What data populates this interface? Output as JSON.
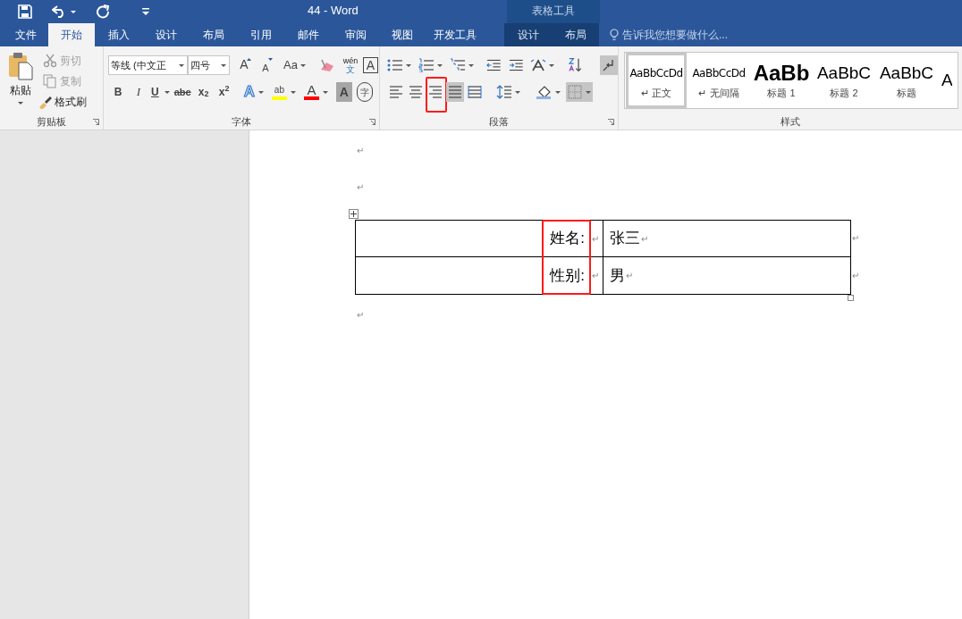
{
  "window": {
    "title": "44 - Word",
    "context_title": "表格工具"
  },
  "tabs": [
    {
      "label": "文件",
      "selected": false,
      "context": false
    },
    {
      "label": "开始",
      "selected": true,
      "context": false
    },
    {
      "label": "插入",
      "selected": false,
      "context": false
    },
    {
      "label": "设计",
      "selected": false,
      "context": false
    },
    {
      "label": "布局",
      "selected": false,
      "context": false
    },
    {
      "label": "引用",
      "selected": false,
      "context": false
    },
    {
      "label": "邮件",
      "selected": false,
      "context": false
    },
    {
      "label": "审阅",
      "selected": false,
      "context": false
    },
    {
      "label": "视图",
      "selected": false,
      "context": false
    },
    {
      "label": "开发工具",
      "selected": false,
      "context": false
    },
    {
      "label": "设计",
      "selected": false,
      "context": true
    },
    {
      "label": "布局",
      "selected": false,
      "context": true
    }
  ],
  "tell_me": {
    "placeholder": "告诉我您想要做什么..."
  },
  "clipboard": {
    "label": "剪贴板",
    "paste": "粘贴",
    "items": [
      {
        "kind": "cut",
        "label": "剪切",
        "disabled": true
      },
      {
        "kind": "copy",
        "label": "复制",
        "disabled": true
      },
      {
        "kind": "painter",
        "label": "格式刷",
        "disabled": false
      }
    ]
  },
  "font": {
    "label": "字体",
    "font_name": "等线 (中文正",
    "font_size": "四号",
    "row1": [
      {
        "kind": "grow",
        "glyph": "A"
      },
      {
        "kind": "shrink",
        "glyph": "A"
      },
      {
        "kind": "case",
        "glyph": "Aa"
      },
      {
        "kind": "clear"
      },
      {
        "kind": "phonetic",
        "glyph": "wén",
        "sub": "文"
      },
      {
        "kind": "boxed",
        "glyph": "A"
      }
    ],
    "row2": [
      {
        "kind": "bold",
        "glyph": "B"
      },
      {
        "kind": "italic",
        "glyph": "I"
      },
      {
        "kind": "underline",
        "glyph": "U"
      },
      {
        "kind": "strike",
        "glyph": "abc"
      },
      {
        "kind": "script",
        "glyph": "x$_{2}$"
      },
      {
        "kind": "script",
        "glyph": "x$^{2}$"
      },
      {
        "kind": "effect",
        "glyph": "A"
      },
      {
        "kind": "highlight",
        "glyph": "ab"
      },
      {
        "kind": "color",
        "glyph": "A"
      },
      {
        "kind": "shade",
        "glyph": "A"
      },
      {
        "kind": "enclose",
        "glyph": "字"
      }
    ]
  },
  "paragraph": {
    "label": "段落",
    "show_marks": true,
    "borders_active": true,
    "alignments": [
      {
        "kind": "left",
        "selected": false,
        "outlined": false
      },
      {
        "kind": "center",
        "selected": false,
        "outlined": false
      },
      {
        "kind": "right",
        "selected": false,
        "outlined": true
      },
      {
        "kind": "justify",
        "selected": true,
        "outlined": false
      },
      {
        "kind": "distributed",
        "selected": false,
        "outlined": false
      }
    ]
  },
  "styles": {
    "label": "样式",
    "items": [
      {
        "kind": "normal",
        "preview": "AaBbCcDd",
        "name": "↵ 正文",
        "selected": true
      },
      {
        "kind": "normal",
        "preview": "AaBbCcDd",
        "name": "↵ 无间隔",
        "selected": false
      },
      {
        "kind": "heading1",
        "preview": "AaBb",
        "name": "标题 1",
        "selected": false
      },
      {
        "kind": "heading2",
        "preview": "AaBbC",
        "name": "标题 2",
        "selected": false
      },
      {
        "kind": "heading2",
        "preview": "AaBbC",
        "name": "标题",
        "selected": false
      },
      {
        "kind": "partial",
        "preview": "A",
        "selected": false
      }
    ]
  },
  "document": {
    "before": [
      "↵",
      "↵"
    ],
    "table": {
      "label_column_outlined": true,
      "rows": [
        {
          "cells": [
            {
              "text": "姓名:",
              "mark": "↵"
            },
            {
              "text": "张三",
              "mark": "↵"
            }
          ],
          "row_mark": "↵"
        },
        {
          "cells": [
            {
              "text": "性别:",
              "mark": "↵"
            },
            {
              "text": "男",
              "mark": "↵"
            }
          ],
          "row_mark": "↵"
        }
      ]
    },
    "after": [
      "↵"
    ]
  }
}
